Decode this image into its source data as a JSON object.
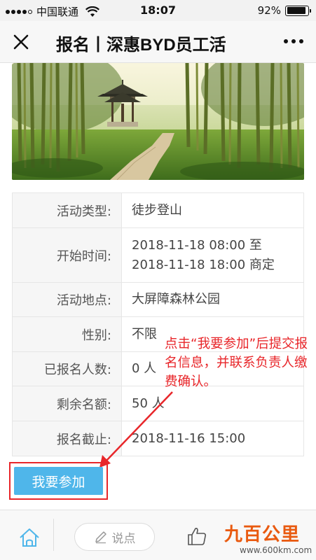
{
  "status_bar": {
    "carrier": "中国联通",
    "time": "18:07",
    "battery_percent": "92%",
    "battery_level": 0.92
  },
  "title_bar": {
    "title": "报名丨深惠BYD员工活",
    "close_icon": "close-icon",
    "more_icon": "more-dots-icon"
  },
  "details": [
    {
      "label": "活动类型:",
      "value": [
        "徒步登山"
      ]
    },
    {
      "label": "开始时间:",
      "value": [
        "2018-11-18 08:00 至",
        "2018-11-18 18:00 商定"
      ]
    },
    {
      "label": "活动地点:",
      "value": [
        "大屏障森林公园"
      ]
    },
    {
      "label": "性别:",
      "value": [
        "不限"
      ]
    },
    {
      "label": "已报名人数:",
      "value": [
        "0 人"
      ]
    },
    {
      "label": "剩余名额:",
      "value": [
        "50 人"
      ]
    },
    {
      "label": "报名截止:",
      "value": [
        "2018-11-16 15:00"
      ]
    }
  ],
  "join_button": {
    "label": "我要参加"
  },
  "annotation": {
    "text": "点击“我要参加”后提交报名信息，并联系负责人缴费确认。",
    "color": "#e8262a"
  },
  "bottom_bar": {
    "comment_label": "说点",
    "home_icon": "home-icon",
    "comment_icon": "pencil-icon",
    "like_icon": "thumbs-up-icon"
  },
  "watermark": {
    "logo_text": "九百公里",
    "url": "www.600km.com"
  },
  "colors": {
    "accent": "#4fb6ea",
    "annotation_red": "#e8262a"
  }
}
